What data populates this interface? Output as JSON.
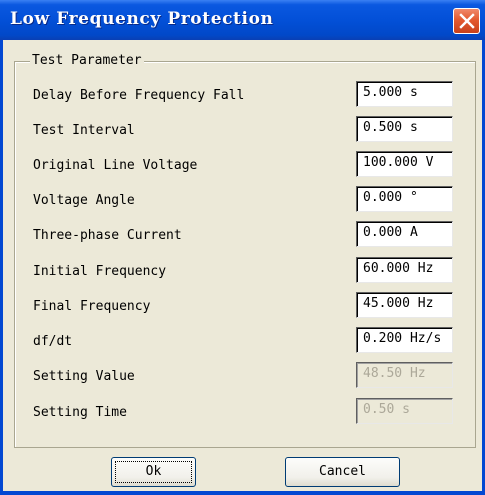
{
  "window": {
    "title": "Low Frequency Protection"
  },
  "group": {
    "legend": "Test Parameter"
  },
  "rows": [
    {
      "label": "Delay Before Frequency Fall",
      "value": "5.000 s"
    },
    {
      "label": "Test Interval",
      "value": "0.500 s"
    },
    {
      "label": "Original Line Voltage",
      "value": "100.000 V"
    },
    {
      "label": "Voltage Angle",
      "value": "0.000 °"
    },
    {
      "label": "Three-phase Current",
      "value": "0.000 A"
    },
    {
      "label": "Initial Frequency",
      "value": "60.000 Hz"
    },
    {
      "label": "Final Frequency",
      "value": "45.000 Hz"
    },
    {
      "label": "df/dt",
      "value": "0.200 Hz/s"
    },
    {
      "label": "Setting Value",
      "value": "48.50 Hz"
    },
    {
      "label": "Setting Time",
      "value": "0.50 s"
    }
  ],
  "buttons": {
    "ok": "Ok",
    "cancel": "Cancel"
  },
  "colors": {
    "titlebar": "#0350d8",
    "close": "#e35a30",
    "dialog_bg": "#ece9d8",
    "disabled_text": "#aca899"
  },
  "icons": {
    "close": "close-icon"
  }
}
